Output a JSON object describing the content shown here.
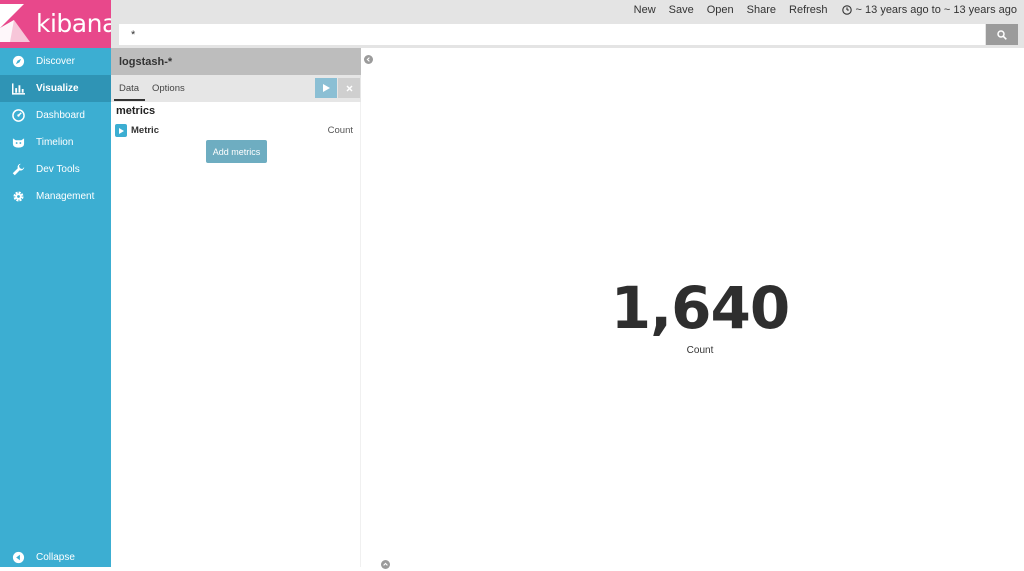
{
  "app": {
    "logo_text": "kibana"
  },
  "sidebar": {
    "items": [
      {
        "label": "Discover",
        "icon": "compass-icon"
      },
      {
        "label": "Visualize",
        "icon": "bar-chart-icon",
        "active": true
      },
      {
        "label": "Dashboard",
        "icon": "dashboard-icon"
      },
      {
        "label": "Timelion",
        "icon": "timelion-icon"
      },
      {
        "label": "Dev Tools",
        "icon": "wrench-icon"
      },
      {
        "label": "Management",
        "icon": "gear-icon"
      }
    ],
    "collapse_label": "Collapse"
  },
  "toolbar": {
    "new": "New",
    "save": "Save",
    "open": "Open",
    "share": "Share",
    "refresh": "Refresh",
    "time_range": "~ 13 years ago to ~ 13 years ago"
  },
  "search": {
    "query": "*"
  },
  "editor": {
    "index_pattern": "logstash-*",
    "tabs": {
      "data": "Data",
      "options": "Options"
    },
    "section_title": "metrics",
    "aggregation": {
      "title": "Metric",
      "value": "Count"
    },
    "add_button": "Add metrics"
  },
  "metric": {
    "value": "1,640",
    "label": "Count"
  },
  "colors": {
    "sidebar": "#3caed2",
    "sidebar_active": "#2f94b5",
    "logo_bg": "#e8488b",
    "accent_button": "#6eadc1"
  }
}
